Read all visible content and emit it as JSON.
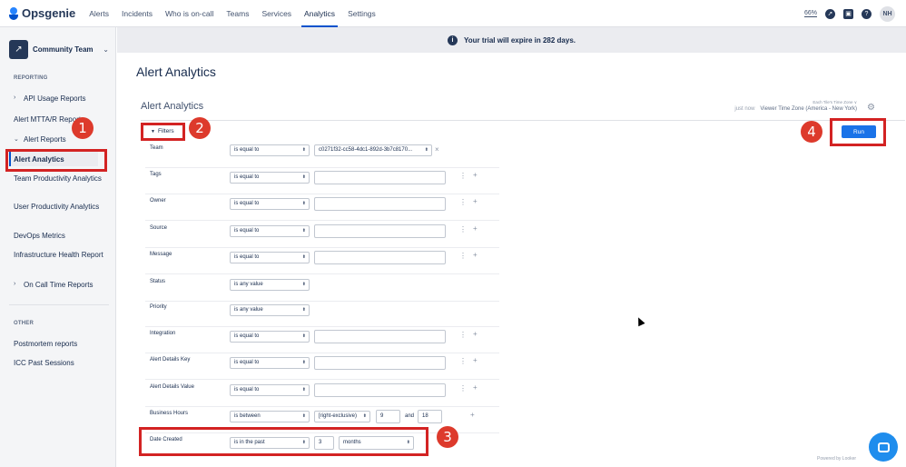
{
  "app": {
    "name": "Opsgenie"
  },
  "nav": {
    "items": [
      "Alerts",
      "Incidents",
      "Who is on-call",
      "Teams",
      "Services",
      "Analytics",
      "Settings"
    ],
    "active": "Analytics",
    "zoom": "66%",
    "avatar_initials": "NH"
  },
  "sidebar": {
    "team": "Community Team",
    "reporting_header": "REPORTING",
    "items": {
      "api_usage": "API Usage Reports",
      "mtta": "Alert MTTA/R Reports",
      "alert_reports": "Alert Reports",
      "alert_analytics": "Alert Analytics",
      "team_productivity": "Team Productivity Analytics",
      "user_productivity": "User Productivity Analytics",
      "devops": "DevOps Metrics",
      "infra": "Infrastructure Health Report",
      "oncall": "On Call Time Reports"
    },
    "other_header": "OTHER",
    "other_items": {
      "postmortem": "Postmortem reports",
      "icc": "ICC Past Sessions"
    }
  },
  "banner": {
    "text": "Your trial will expire in 282 days."
  },
  "page": {
    "title": "Alert Analytics"
  },
  "dashboard": {
    "title": "Alert Analytics",
    "timezone_caption": "Each Tile's Time Zone ∨",
    "last_run": "just now",
    "timezone": "Viewer Time Zone (America - New York)",
    "filters_label": "Filters",
    "run_label": "Run"
  },
  "filters": {
    "team": {
      "label": "Team",
      "op": "is equal to",
      "value": "c0271f32-cc58-4dc1-892d-3b7c8170..."
    },
    "tags": {
      "label": "Tags",
      "op": "is equal to"
    },
    "owner": {
      "label": "Owner",
      "op": "is equal to"
    },
    "source": {
      "label": "Source",
      "op": "is equal to"
    },
    "message": {
      "label": "Message",
      "op": "is equal to"
    },
    "status": {
      "label": "Status",
      "op": "is any value"
    },
    "priority": {
      "label": "Priority",
      "op": "is any value"
    },
    "integration": {
      "label": "Integration",
      "op": "is equal to"
    },
    "details_key": {
      "label": "Alert Details Key",
      "op": "is equal to"
    },
    "details_value": {
      "label": "Alert Details Value",
      "op": "is equal to"
    },
    "business_hours": {
      "label": "Business Hours",
      "op": "is between",
      "mode": "[right-exclusive)",
      "from": "9",
      "and": "and",
      "to": "18"
    },
    "date_created": {
      "label": "Date Created",
      "op": "is in the past",
      "amount": "3",
      "unit": "months"
    }
  },
  "annotations": [
    "1",
    "2",
    "3",
    "4"
  ],
  "footer": {
    "powered": "Powered by Looker"
  },
  "colors": {
    "accent": "#0052cc",
    "annotation": "#d32323",
    "run": "#1a73e8"
  }
}
